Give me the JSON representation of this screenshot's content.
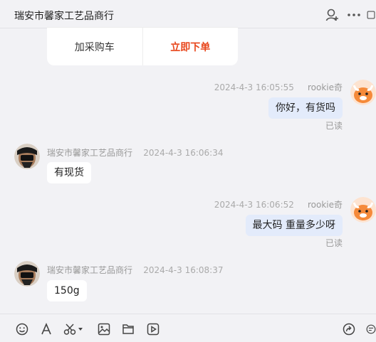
{
  "header": {
    "title": "瑞安市馨家工艺品商行"
  },
  "order_card": {
    "add_to_cart_label": "加采购车",
    "buy_now_label": "立即下单"
  },
  "messages": [
    {
      "sender": "rookie奇",
      "time": "2024-4-3 16:05:55",
      "text": "你好，有货吗",
      "status": "已读"
    },
    {
      "sender": "瑞安市馨家工艺品商行",
      "time": "2024-4-3 16:06:34",
      "text": "有现货"
    },
    {
      "sender": "rookie奇",
      "time": "2024-4-3 16:06:52",
      "text": "最大码  重量多少呀",
      "status": "已读"
    },
    {
      "sender": "瑞安市馨家工艺品商行",
      "time": "2024-4-3 16:08:37",
      "text": "150g"
    }
  ],
  "icons": {
    "header": [
      "add-user-icon",
      "more-icon"
    ],
    "toolbar": [
      "emoji-icon",
      "font-icon",
      "scissors-icon",
      "image-icon",
      "file-icon",
      "video-icon",
      "share-icon",
      "quick-reply-icon"
    ]
  },
  "colors": {
    "accent": "#e8461b",
    "my_bubble": "#e3ebfb",
    "their_bubble": "#ffffff",
    "background": "#f2f2f5"
  }
}
